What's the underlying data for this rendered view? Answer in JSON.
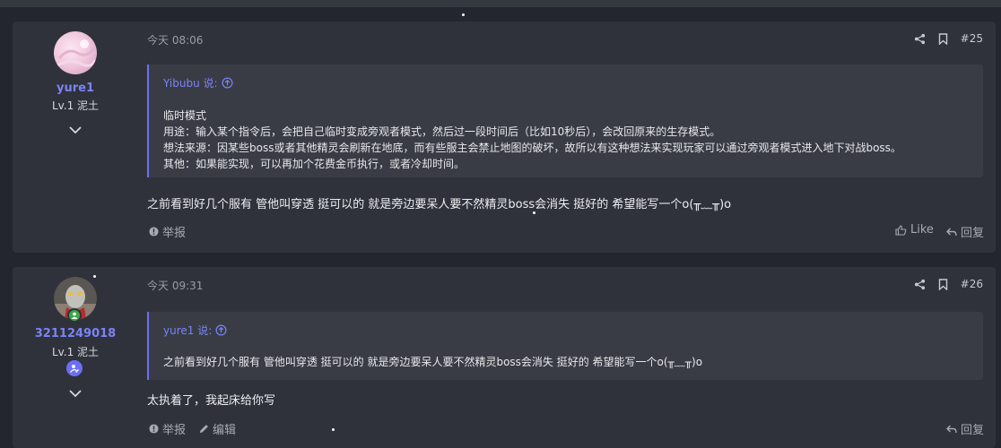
{
  "posts": [
    {
      "username": "yure1",
      "level": "Lv.1 泥土",
      "time": "今天 08:06",
      "number": "#25",
      "quote": {
        "author_line": "Yibubu 说:",
        "lines": [
          "临时模式",
          "用途：输入某个指令后，会把自己临时变成旁观者模式，然后过一段时间后（比如10秒后），会改回原来的生存模式。",
          "想法来源：因某些boss或者其他精灵会刷新在地底，而有些服主会禁止地图的破坏，故所以有这种想法来实现玩家可以通过旁观者模式进入地下对战boss。",
          "其他：如果能实现，可以再加个花费金币执行，或者冷却时间。"
        ]
      },
      "content": "之前看到好几个服有 管他叫穿透 挺可以的 就是旁边要呆人要不然精灵boss会消失 挺好的 希望能写一个o(╥﹏╥)o",
      "report": "举报",
      "like": "Like",
      "reply": "回复"
    },
    {
      "username": "3211249018",
      "level": "Lv.1 泥土",
      "time": "今天 09:31",
      "number": "#26",
      "quote": {
        "author_line": "yure1 说:",
        "lines": [
          "之前看到好几个服有 管他叫穿透 挺可以的 就是旁边要呆人要不然精灵boss会消失 挺好的 希望能写一个o(╥﹏╥)o"
        ]
      },
      "content": "太执着了，我起床给你写",
      "report": "举报",
      "edit": "编辑",
      "reply": "回复"
    }
  ],
  "colors": {
    "accent": "#7b83f7",
    "background": "#23262e",
    "card": "#2f323b",
    "quote_bg": "#393c45",
    "online_badge": "#3fa74a"
  }
}
